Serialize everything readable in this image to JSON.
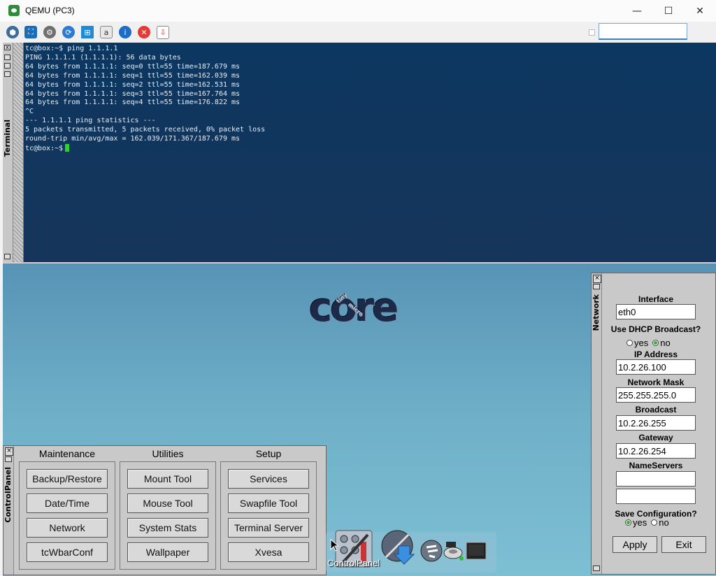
{
  "window": {
    "title": "QEMU (PC3)",
    "controls": {
      "minimize": "—",
      "maximize": "☐",
      "close": "✕"
    }
  },
  "toolbar": {
    "icons": [
      "network-icon",
      "fullscreen-icon",
      "settings-icon",
      "refresh-icon",
      "windows-icon",
      "console-icon",
      "info-icon",
      "stop-icon",
      "capture-icon"
    ],
    "search_value": ""
  },
  "terminal": {
    "label": "Terminal",
    "lines": [
      "tc@box:~$ ping 1.1.1.1",
      "PING 1.1.1.1 (1.1.1.1): 56 data bytes",
      "64 bytes from 1.1.1.1: seq=0 ttl=55 time=187.679 ms",
      "64 bytes from 1.1.1.1: seq=1 ttl=55 time=162.039 ms",
      "64 bytes from 1.1.1.1: seq=2 ttl=55 time=162.531 ms",
      "64 bytes from 1.1.1.1: seq=3 ttl=55 time=167.764 ms",
      "64 bytes from 1.1.1.1: seq=4 ttl=55 time=176.822 ms",
      "^C",
      "--- 1.1.1.1 ping statistics ---",
      "5 packets transmitted, 5 packets received, 0% packet loss",
      "round-trip min/avg/max = 162.039/171.367/187.679 ms"
    ],
    "prompt": "tc@box:~$"
  },
  "desktop": {
    "logo_text": "core",
    "logo_small_1": "tiny",
    "logo_small_2": "micro"
  },
  "network": {
    "panel_label": "Network",
    "interface_label": "Interface",
    "interface_value": "eth0",
    "dhcp_label": "Use DHCP Broadcast?",
    "dhcp_yes": "yes",
    "dhcp_no": "no",
    "dhcp_selected": "no",
    "ip_label": "IP Address",
    "ip_value": "10.2.26.100",
    "mask_label": "Network Mask",
    "mask_value": "255.255.255.0",
    "broadcast_label": "Broadcast",
    "broadcast_value": "10.2.26.255",
    "gateway_label": "Gateway",
    "gateway_value": "10.2.26.254",
    "ns_label": "NameServers",
    "ns1_value": "",
    "ns2_value": "",
    "save_label": "Save Configuration?",
    "save_yes": "yes",
    "save_no": "no",
    "save_selected": "yes",
    "apply": "Apply",
    "exit": "Exit"
  },
  "control_panel": {
    "label": "ControlPanel",
    "columns": [
      {
        "title": "Maintenance",
        "buttons": [
          "Backup/Restore",
          "Date/Time",
          "Network",
          "tcWbarConf"
        ]
      },
      {
        "title": "Utilities",
        "buttons": [
          "Mount Tool",
          "Mouse Tool",
          "System Stats",
          "Wallpaper"
        ]
      },
      {
        "title": "Setup",
        "buttons": [
          "Services",
          "Swapfile Tool",
          "Terminal Server",
          "Xvesa"
        ]
      }
    ]
  },
  "wbar": {
    "hover_label": "ControlPanel",
    "icons": [
      "control-panel-icon",
      "apps-icon",
      "run-icon",
      "mount-icon",
      "terminal-icon"
    ]
  }
}
